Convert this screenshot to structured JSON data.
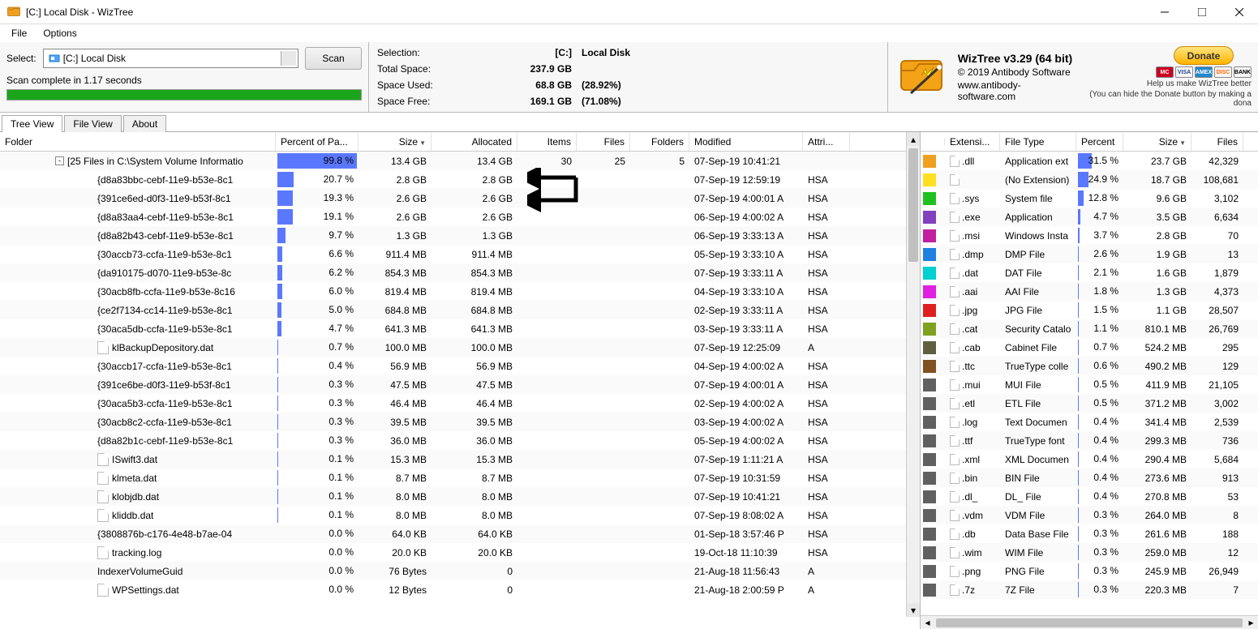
{
  "window": {
    "title": "[C:] Local Disk  -  WizTree"
  },
  "menu": {
    "file": "File",
    "options": "Options"
  },
  "scan": {
    "select_label": "Select:",
    "drive_text": "[C:] Local Disk",
    "scan_button": "Scan",
    "status": "Scan complete in 1.17 seconds"
  },
  "stats": {
    "selection_label": "Selection:",
    "selection_drive": "[C:]",
    "selection_name": "Local Disk",
    "total_label": "Total Space:",
    "total_val": "237.9 GB",
    "used_label": "Space Used:",
    "used_val": "68.8 GB",
    "used_pct": "(28.92%)",
    "free_label": "Space Free:",
    "free_val": "169.1 GB",
    "free_pct": "(71.08%)"
  },
  "about": {
    "version": "WizTree v3.29 (64 bit)",
    "copyright": "© 2019 Antibody Software",
    "url": "www.antibody-software.com",
    "donate": "Donate",
    "cards": [
      "MC",
      "VISA",
      "AMEX",
      "DISC",
      "BANK"
    ],
    "help_text": "Help us make WizTree better",
    "hide_note": "(You can hide the Donate button by making a dona"
  },
  "tabs": {
    "tree": "Tree View",
    "file": "File View",
    "about": "About"
  },
  "left_cols": {
    "folder": "Folder",
    "pct": "Percent of Pa...",
    "size": "Size",
    "alloc": "Allocated",
    "items": "Items",
    "files": "Files",
    "folders": "Folders",
    "modified": "Modified",
    "attr": "Attri..."
  },
  "right_cols": {
    "ext": "Extensi...",
    "type": "File Type",
    "pct": "Percent",
    "size": "Size",
    "files": "Files"
  },
  "rows": [
    {
      "name": "[25 Files in C:\\System Volume Informatio",
      "pct": "99.8 %",
      "bar": 99.8,
      "size": "13.4 GB",
      "alloc": "13.4 GB",
      "items": "30",
      "files": "25",
      "folders": "5",
      "mod": "07-Sep-19 10:41:21",
      "attr": "",
      "toggle": "-",
      "icon": ""
    },
    {
      "name": "{d8a83bbc-cebf-11e9-b53e-8c1",
      "pct": "20.7 %",
      "bar": 20.7,
      "size": "2.8 GB",
      "alloc": "2.8 GB",
      "items": "",
      "files": "",
      "folders": "",
      "mod": "07-Sep-19 12:59:19",
      "attr": "HSA",
      "icon": ""
    },
    {
      "name": "{391ce6ed-d0f3-11e9-b53f-8c1",
      "pct": "19.3 %",
      "bar": 19.3,
      "size": "2.6 GB",
      "alloc": "2.6 GB",
      "items": "",
      "files": "",
      "folders": "",
      "mod": "07-Sep-19 4:00:01 A",
      "attr": "HSA",
      "icon": ""
    },
    {
      "name": "{d8a83aa4-cebf-11e9-b53e-8c1",
      "pct": "19.1 %",
      "bar": 19.1,
      "size": "2.6 GB",
      "alloc": "2.6 GB",
      "items": "",
      "files": "",
      "folders": "",
      "mod": "06-Sep-19 4:00:02 A",
      "attr": "HSA",
      "icon": ""
    },
    {
      "name": "{d8a82b43-cebf-11e9-b53e-8c1",
      "pct": "9.7 %",
      "bar": 9.7,
      "size": "1.3 GB",
      "alloc": "1.3 GB",
      "items": "",
      "files": "",
      "folders": "",
      "mod": "06-Sep-19 3:33:13 A",
      "attr": "HSA",
      "icon": ""
    },
    {
      "name": "{30accb73-ccfa-11e9-b53e-8c1",
      "pct": "6.6 %",
      "bar": 6.6,
      "size": "911.4 MB",
      "alloc": "911.4 MB",
      "items": "",
      "files": "",
      "folders": "",
      "mod": "05-Sep-19 3:33:10 A",
      "attr": "HSA",
      "icon": ""
    },
    {
      "name": "{da910175-d070-11e9-b53e-8c",
      "pct": "6.2 %",
      "bar": 6.2,
      "size": "854.3 MB",
      "alloc": "854.3 MB",
      "items": "",
      "files": "",
      "folders": "",
      "mod": "07-Sep-19 3:33:11 A",
      "attr": "HSA",
      "icon": ""
    },
    {
      "name": "{30acb8fb-ccfa-11e9-b53e-8c16",
      "pct": "6.0 %",
      "bar": 6.0,
      "size": "819.4 MB",
      "alloc": "819.4 MB",
      "items": "",
      "files": "",
      "folders": "",
      "mod": "04-Sep-19 3:33:10 A",
      "attr": "HSA",
      "icon": ""
    },
    {
      "name": "{ce2f7134-cc14-11e9-b53e-8c1",
      "pct": "5.0 %",
      "bar": 5.0,
      "size": "684.8 MB",
      "alloc": "684.8 MB",
      "items": "",
      "files": "",
      "folders": "",
      "mod": "02-Sep-19 3:33:11 A",
      "attr": "HSA",
      "icon": ""
    },
    {
      "name": "{30aca5db-ccfa-11e9-b53e-8c1",
      "pct": "4.7 %",
      "bar": 4.7,
      "size": "641.3 MB",
      "alloc": "641.3 MB",
      "items": "",
      "files": "",
      "folders": "",
      "mod": "03-Sep-19 3:33:11 A",
      "attr": "HSA",
      "icon": ""
    },
    {
      "name": "klBackupDepository.dat",
      "pct": "0.7 %",
      "bar": 0.7,
      "size": "100.0 MB",
      "alloc": "100.0 MB",
      "items": "",
      "files": "",
      "folders": "",
      "mod": "07-Sep-19 12:25:09",
      "attr": "A",
      "icon": "file"
    },
    {
      "name": "{30accb17-ccfa-11e9-b53e-8c1",
      "pct": "0.4 %",
      "bar": 0.4,
      "size": "56.9 MB",
      "alloc": "56.9 MB",
      "items": "",
      "files": "",
      "folders": "",
      "mod": "04-Sep-19 4:00:02 A",
      "attr": "HSA",
      "icon": ""
    },
    {
      "name": "{391ce6be-d0f3-11e9-b53f-8c1",
      "pct": "0.3 %",
      "bar": 0.3,
      "size": "47.5 MB",
      "alloc": "47.5 MB",
      "items": "",
      "files": "",
      "folders": "",
      "mod": "07-Sep-19 4:00:01 A",
      "attr": "HSA",
      "icon": ""
    },
    {
      "name": "{30aca5b3-ccfa-11e9-b53e-8c1",
      "pct": "0.3 %",
      "bar": 0.3,
      "size": "46.4 MB",
      "alloc": "46.4 MB",
      "items": "",
      "files": "",
      "folders": "",
      "mod": "02-Sep-19 4:00:02 A",
      "attr": "HSA",
      "icon": ""
    },
    {
      "name": "{30acb8c2-ccfa-11e9-b53e-8c1",
      "pct": "0.3 %",
      "bar": 0.3,
      "size": "39.5 MB",
      "alloc": "39.5 MB",
      "items": "",
      "files": "",
      "folders": "",
      "mod": "03-Sep-19 4:00:02 A",
      "attr": "HSA",
      "icon": ""
    },
    {
      "name": "{d8a82b1c-cebf-11e9-b53e-8c1",
      "pct": "0.3 %",
      "bar": 0.3,
      "size": "36.0 MB",
      "alloc": "36.0 MB",
      "items": "",
      "files": "",
      "folders": "",
      "mod": "05-Sep-19 4:00:02 A",
      "attr": "HSA",
      "icon": ""
    },
    {
      "name": "ISwift3.dat",
      "pct": "0.1 %",
      "bar": 0.1,
      "size": "15.3 MB",
      "alloc": "15.3 MB",
      "items": "",
      "files": "",
      "folders": "",
      "mod": "07-Sep-19 1:11:21 A",
      "attr": "HSA",
      "icon": "file"
    },
    {
      "name": "klmeta.dat",
      "pct": "0.1 %",
      "bar": 0.1,
      "size": "8.7 MB",
      "alloc": "8.7 MB",
      "items": "",
      "files": "",
      "folders": "",
      "mod": "07-Sep-19 10:31:59",
      "attr": "HSA",
      "icon": "file"
    },
    {
      "name": "klobjdb.dat",
      "pct": "0.1 %",
      "bar": 0.1,
      "size": "8.0 MB",
      "alloc": "8.0 MB",
      "items": "",
      "files": "",
      "folders": "",
      "mod": "07-Sep-19 10:41:21",
      "attr": "HSA",
      "icon": "file"
    },
    {
      "name": "kliddb.dat",
      "pct": "0.1 %",
      "bar": 0.1,
      "size": "8.0 MB",
      "alloc": "8.0 MB",
      "items": "",
      "files": "",
      "folders": "",
      "mod": "07-Sep-19 8:08:02 A",
      "attr": "HSA",
      "icon": "file"
    },
    {
      "name": "{3808876b-c176-4e48-b7ae-04",
      "pct": "0.0 %",
      "bar": 0,
      "size": "64.0 KB",
      "alloc": "64.0 KB",
      "items": "",
      "files": "",
      "folders": "",
      "mod": "01-Sep-18 3:57:46 P",
      "attr": "HSA",
      "icon": ""
    },
    {
      "name": "tracking.log",
      "pct": "0.0 %",
      "bar": 0,
      "size": "20.0 KB",
      "alloc": "20.0 KB",
      "items": "",
      "files": "",
      "folders": "",
      "mod": "19-Oct-18 11:10:39",
      "attr": "HSA",
      "icon": "file"
    },
    {
      "name": "IndexerVolumeGuid",
      "pct": "0.0 %",
      "bar": 0,
      "size": "76 Bytes",
      "alloc": "0",
      "items": "",
      "files": "",
      "folders": "",
      "mod": "21-Aug-18 11:56:43",
      "attr": "A",
      "icon": ""
    },
    {
      "name": "WPSettings.dat",
      "pct": "0.0 %",
      "bar": 0,
      "size": "12 Bytes",
      "alloc": "0",
      "items": "",
      "files": "",
      "folders": "",
      "mod": "21-Aug-18 2:00:59 P",
      "attr": "A",
      "icon": "file"
    }
  ],
  "exts": [
    {
      "color": "#f0a020",
      "ext": ".dll",
      "type": "Application ext",
      "pct": "31.5 %",
      "bar": 31.5,
      "size": "23.7 GB",
      "files": "42,329"
    },
    {
      "color": "#ffe020",
      "ext": "",
      "type": "(No Extension)",
      "pct": "24.9 %",
      "bar": 24.9,
      "size": "18.7 GB",
      "files": "108,681"
    },
    {
      "color": "#20c020",
      "ext": ".sys",
      "type": "System file",
      "pct": "12.8 %",
      "bar": 12.8,
      "size": "9.6 GB",
      "files": "3,102"
    },
    {
      "color": "#8040c0",
      "ext": ".exe",
      "type": "Application",
      "pct": "4.7 %",
      "bar": 4.7,
      "size": "3.5 GB",
      "files": "6,634"
    },
    {
      "color": "#c020a0",
      "ext": ".msi",
      "type": "Windows Insta",
      "pct": "3.7 %",
      "bar": 3.7,
      "size": "2.8 GB",
      "files": "70"
    },
    {
      "color": "#2080e0",
      "ext": ".dmp",
      "type": "DMP File",
      "pct": "2.6 %",
      "bar": 2.6,
      "size": "1.9 GB",
      "files": "13"
    },
    {
      "color": "#00d0d0",
      "ext": ".dat",
      "type": "DAT File",
      "pct": "2.1 %",
      "bar": 2.1,
      "size": "1.6 GB",
      "files": "1,879"
    },
    {
      "color": "#e020e0",
      "ext": ".aai",
      "type": "AAI File",
      "pct": "1.8 %",
      "bar": 1.8,
      "size": "1.3 GB",
      "files": "4,373"
    },
    {
      "color": "#e02020",
      "ext": ".jpg",
      "type": "JPG File",
      "pct": "1.5 %",
      "bar": 1.5,
      "size": "1.1 GB",
      "files": "28,507"
    },
    {
      "color": "#80a020",
      "ext": ".cat",
      "type": "Security Catalo",
      "pct": "1.1 %",
      "bar": 1.1,
      "size": "810.1 MB",
      "files": "26,769"
    },
    {
      "color": "#606040",
      "ext": ".cab",
      "type": "Cabinet File",
      "pct": "0.7 %",
      "bar": 0.7,
      "size": "524.2 MB",
      "files": "295"
    },
    {
      "color": "#805020",
      "ext": ".ttc",
      "type": "TrueType colle",
      "pct": "0.6 %",
      "bar": 0.6,
      "size": "490.2 MB",
      "files": "129"
    },
    {
      "color": "#606060",
      "ext": ".mui",
      "type": "MUI File",
      "pct": "0.5 %",
      "bar": 0.5,
      "size": "411.9 MB",
      "files": "21,105"
    },
    {
      "color": "#606060",
      "ext": ".etl",
      "type": "ETL File",
      "pct": "0.5 %",
      "bar": 0.5,
      "size": "371.2 MB",
      "files": "3,002"
    },
    {
      "color": "#606060",
      "ext": ".log",
      "type": "Text Documen",
      "pct": "0.4 %",
      "bar": 0.4,
      "size": "341.4 MB",
      "files": "2,539"
    },
    {
      "color": "#606060",
      "ext": ".ttf",
      "type": "TrueType font",
      "pct": "0.4 %",
      "bar": 0.4,
      "size": "299.3 MB",
      "files": "736"
    },
    {
      "color": "#606060",
      "ext": ".xml",
      "type": "XML Documen",
      "pct": "0.4 %",
      "bar": 0.4,
      "size": "290.4 MB",
      "files": "5,684"
    },
    {
      "color": "#606060",
      "ext": ".bin",
      "type": "BIN File",
      "pct": "0.4 %",
      "bar": 0.4,
      "size": "273.6 MB",
      "files": "913"
    },
    {
      "color": "#606060",
      "ext": ".dl_",
      "type": "DL_ File",
      "pct": "0.4 %",
      "bar": 0.4,
      "size": "270.8 MB",
      "files": "53"
    },
    {
      "color": "#606060",
      "ext": ".vdm",
      "type": "VDM File",
      "pct": "0.3 %",
      "bar": 0.3,
      "size": "264.0 MB",
      "files": "8"
    },
    {
      "color": "#606060",
      "ext": ".db",
      "type": "Data Base File",
      "pct": "0.3 %",
      "bar": 0.3,
      "size": "261.6 MB",
      "files": "188"
    },
    {
      "color": "#606060",
      "ext": ".wim",
      "type": "WIM File",
      "pct": "0.3 %",
      "bar": 0.3,
      "size": "259.0 MB",
      "files": "12"
    },
    {
      "color": "#606060",
      "ext": ".png",
      "type": "PNG File",
      "pct": "0.3 %",
      "bar": 0.3,
      "size": "245.9 MB",
      "files": "26,949"
    },
    {
      "color": "#606060",
      "ext": ".7z",
      "type": "7Z File",
      "pct": "0.3 %",
      "bar": 0.3,
      "size": "220.3 MB",
      "files": "7"
    }
  ]
}
